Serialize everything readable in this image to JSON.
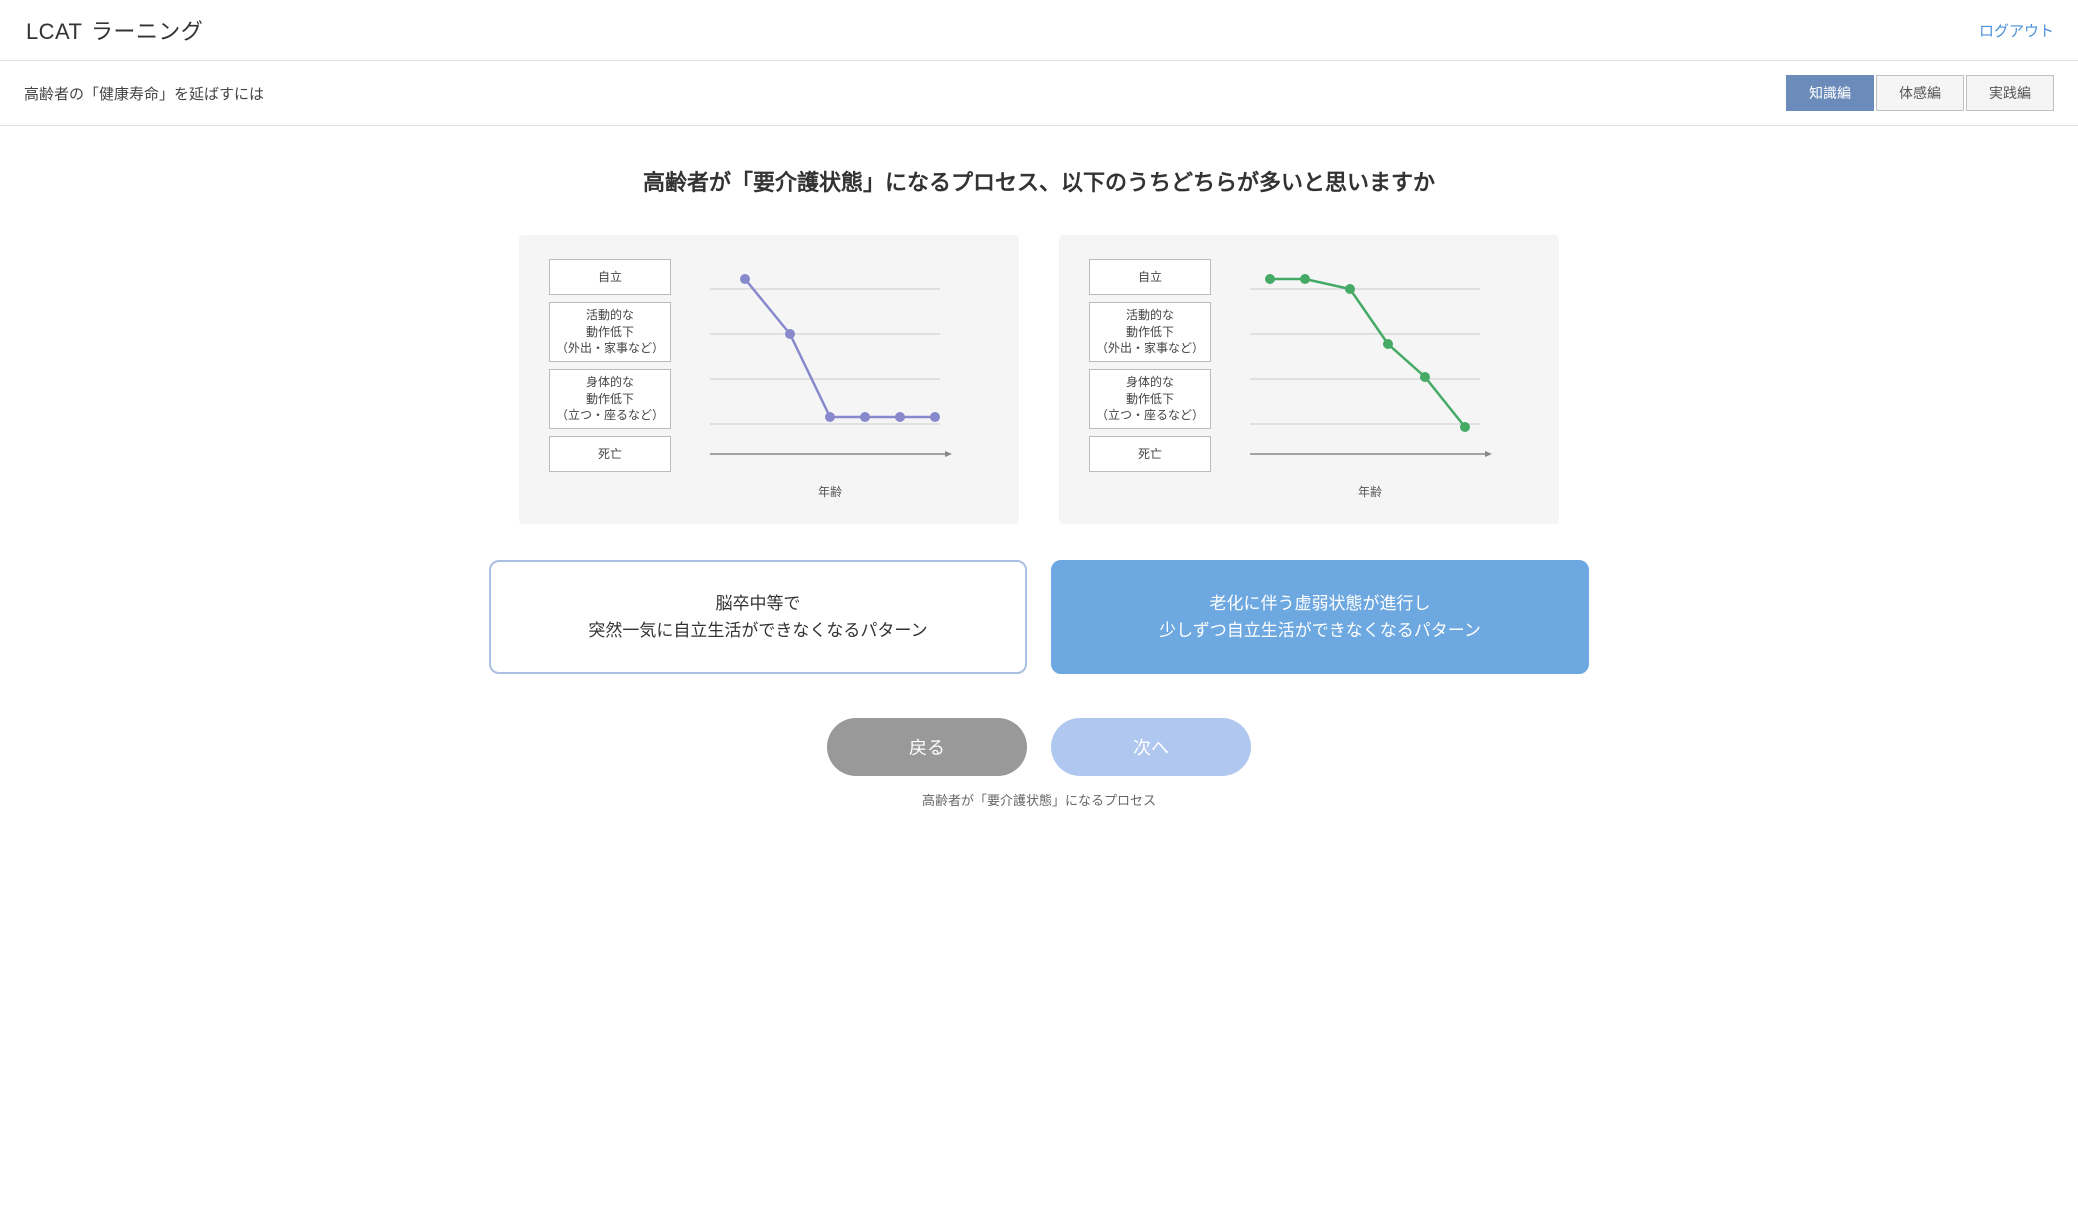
{
  "header": {
    "title_bold": "LCAT",
    "title_normal": "ラーニング",
    "logout_label": "ログアウト"
  },
  "subheader": {
    "text": "高齢者の「健康寿命」を延ばすには",
    "tabs": [
      {
        "label": "知識編",
        "active": true
      },
      {
        "label": "体感編",
        "active": false
      },
      {
        "label": "実践編",
        "active": false
      }
    ]
  },
  "main": {
    "question": "高齢者が「要介護状態」になるプロセス、以下のうちどちらが多いと思いますか",
    "chart_left": {
      "labels": [
        "自立",
        "活動的な動作低下\n（外出・家事など）",
        "身体的な動作低下\n（立つ・座るなど）",
        "死亡"
      ],
      "x_label": "年齢",
      "color": "#8888cc",
      "points": [
        [
          0.15,
          0.07
        ],
        [
          0.38,
          0.35
        ],
        [
          0.55,
          0.72
        ],
        [
          0.7,
          0.72
        ],
        [
          0.82,
          0.72
        ],
        [
          0.93,
          0.72
        ]
      ]
    },
    "chart_right": {
      "labels": [
        "自立",
        "活動的な動作低下\n（外出・家事など）",
        "身体的な動作低下\n（立つ・座るなど）",
        "死亡"
      ],
      "x_label": "年齢",
      "color": "#44aa66",
      "points": [
        [
          0.1,
          0.07
        ],
        [
          0.25,
          0.07
        ],
        [
          0.42,
          0.12
        ],
        [
          0.58,
          0.38
        ],
        [
          0.73,
          0.55
        ],
        [
          0.88,
          0.85
        ]
      ]
    },
    "option_left": {
      "label": "脳卒中等で\n突然一気に自立生活ができなくなるパターン",
      "selected": false
    },
    "option_right": {
      "label": "老化に伴う虚弱状態が進行し\n少しずつ自立生活ができなくなるパターン",
      "selected": true
    },
    "back_label": "戻る",
    "next_label": "次へ",
    "page_label": "高齢者が「要介護状態」になるプロセス"
  }
}
